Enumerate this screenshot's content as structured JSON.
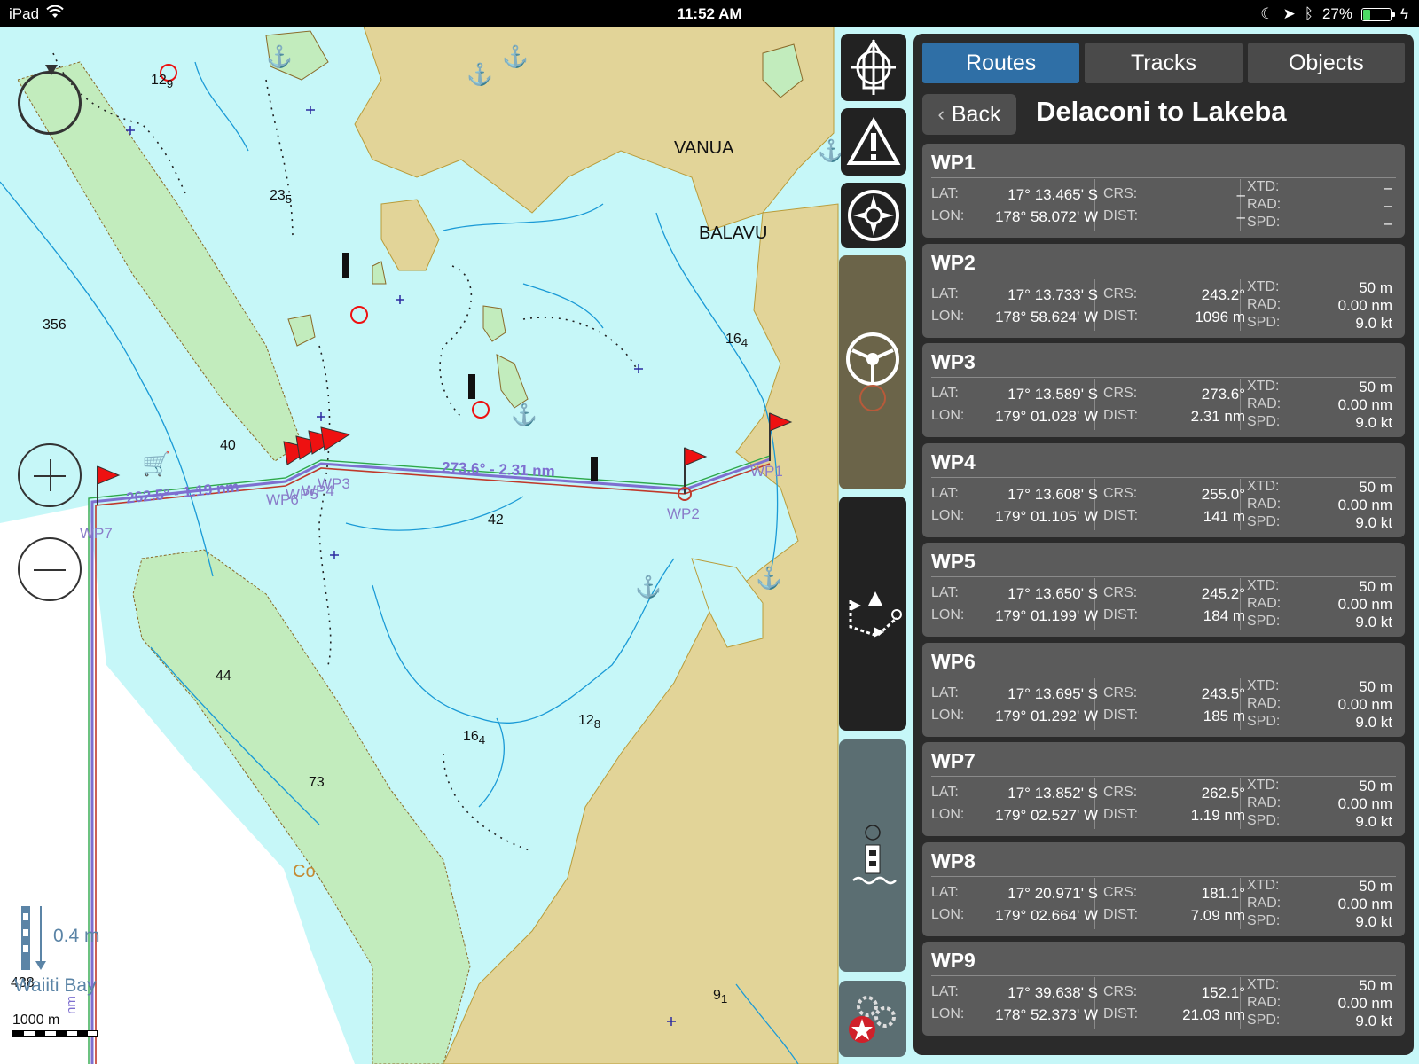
{
  "status_bar": {
    "device": "iPad",
    "time": "11:52 AM",
    "battery": "27%",
    "battery_level": 0.27
  },
  "map": {
    "place_labels": [
      "VANUA",
      "BALAVU",
      "Co",
      "Waiiti Bay"
    ],
    "depths": [
      {
        "main": "12",
        "sub": "9"
      },
      {
        "main": "23",
        "sub": "5"
      },
      {
        "main": "356",
        "sub": ""
      },
      {
        "main": "16",
        "sub": "4"
      },
      {
        "main": "40",
        "sub": ""
      },
      {
        "main": "42",
        "sub": ""
      },
      {
        "main": "44",
        "sub": ""
      },
      {
        "main": "12",
        "sub": "8"
      },
      {
        "main": "16",
        "sub": "4"
      },
      {
        "main": "73",
        "sub": ""
      },
      {
        "main": "9",
        "sub": "1"
      },
      {
        "main": "438",
        "sub": ""
      }
    ],
    "route_labels": [
      "273.6° - 2.31 nm",
      "262.5° - 1.19 nm"
    ],
    "waypoint_labels": [
      "WP1",
      "WP2",
      "WP3",
      "WP4",
      "WP5",
      "WP6",
      "WP7"
    ],
    "tide": "0.4 m",
    "scale": "1000 m",
    "scale_unit": "nm"
  },
  "panel": {
    "tabs": [
      "Routes",
      "Tracks",
      "Objects"
    ],
    "active_tab": "Routes",
    "back_label": "Back",
    "title": "Delaconi to Lakeba",
    "field_labels": {
      "lat": "LAT:",
      "lon": "LON:",
      "crs": "CRS:",
      "dist": "DIST:",
      "xtd": "XTD:",
      "rad": "RAD:",
      "spd": "SPD:"
    },
    "waypoints": [
      {
        "name": "WP1",
        "lat": "17° 13.465' S",
        "lon": "178° 58.072' W",
        "crs": "–",
        "dist": "–",
        "xtd": "–",
        "rad": "–",
        "spd": "–"
      },
      {
        "name": "WP2",
        "lat": "17° 13.733' S",
        "lon": "178° 58.624' W",
        "crs": "243.2°",
        "dist": "1096 m",
        "xtd": "50 m",
        "rad": "0.00 nm",
        "spd": "9.0 kt"
      },
      {
        "name": "WP3",
        "lat": "17° 13.589' S",
        "lon": "179° 01.028' W",
        "crs": "273.6°",
        "dist": "2.31 nm",
        "xtd": "50 m",
        "rad": "0.00 nm",
        "spd": "9.0 kt"
      },
      {
        "name": "WP4",
        "lat": "17° 13.608' S",
        "lon": "179° 01.105' W",
        "crs": "255.0°",
        "dist": "141 m",
        "xtd": "50 m",
        "rad": "0.00 nm",
        "spd": "9.0 kt"
      },
      {
        "name": "WP5",
        "lat": "17° 13.650' S",
        "lon": "179° 01.199' W",
        "crs": "245.2°",
        "dist": "184 m",
        "xtd": "50 m",
        "rad": "0.00 nm",
        "spd": "9.0 kt"
      },
      {
        "name": "WP6",
        "lat": "17° 13.695' S",
        "lon": "179° 01.292' W",
        "crs": "243.5°",
        "dist": "185 m",
        "xtd": "50 m",
        "rad": "0.00 nm",
        "spd": "9.0 kt"
      },
      {
        "name": "WP7",
        "lat": "17° 13.852' S",
        "lon": "179° 02.527' W",
        "crs": "262.5°",
        "dist": "1.19 nm",
        "xtd": "50 m",
        "rad": "0.00 nm",
        "spd": "9.0 kt"
      },
      {
        "name": "WP8",
        "lat": "17° 20.971' S",
        "lon": "179° 02.664' W",
        "crs": "181.1°",
        "dist": "7.09 nm",
        "xtd": "50 m",
        "rad": "0.00 nm",
        "spd": "9.0 kt"
      },
      {
        "name": "WP9",
        "lat": "17° 39.638' S",
        "lon": "178° 52.373' W",
        "crs": "152.1°",
        "dist": "21.03 nm",
        "xtd": "50 m",
        "rad": "0.00 nm",
        "spd": "9.0 kt"
      }
    ]
  },
  "icons": [
    "wifi-icon",
    "moon-icon",
    "location-arrow-icon",
    "bluetooth-icon",
    "battery-icon",
    "charging-icon",
    "boat-center-icon",
    "warning-icon",
    "compass-rose-icon",
    "steering-wheel-icon",
    "route-planning-icon",
    "tide-station-icon",
    "settings-gears-icon",
    "zoom-in-icon",
    "zoom-out-icon",
    "rotation-ring-icon"
  ],
  "colors": {
    "tab_active": "#2f6fa6",
    "water": "#c6f7f8",
    "land": "#e2d498",
    "shallow": "#c2ecbd",
    "route": "#7e6fd0"
  }
}
